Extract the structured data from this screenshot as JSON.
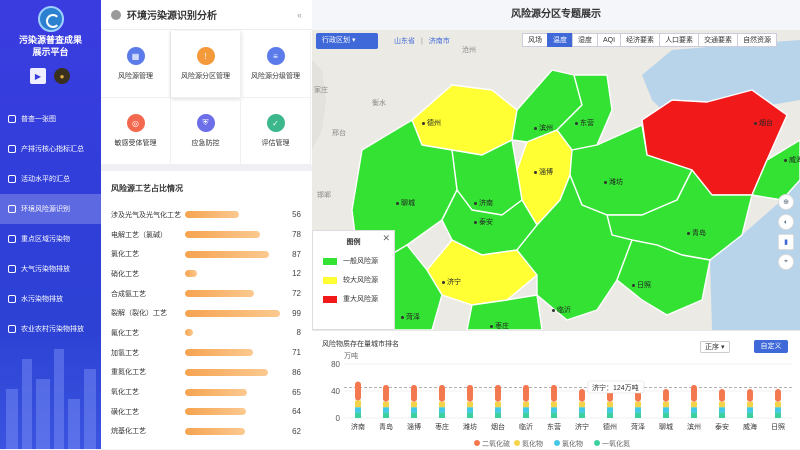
{
  "platform": {
    "title_line1": "污染源普查成果",
    "title_line2": "展示平台"
  },
  "nav": [
    {
      "label": "普查一张图",
      "active": false
    },
    {
      "label": "产排污核心指标汇总",
      "active": false
    },
    {
      "label": "活动水平的汇总",
      "active": false
    },
    {
      "label": "环境风险源识别",
      "active": true
    },
    {
      "label": "重点区域污染物",
      "active": false
    },
    {
      "label": "大气污染物排放",
      "active": false
    },
    {
      "label": "水污染物排放",
      "active": false
    },
    {
      "label": "农业农村污染物排放",
      "active": false
    }
  ],
  "panel": {
    "title": "环境污染源识别分析",
    "tiles": [
      {
        "label": "风险源管理",
        "icon": "building-icon",
        "color": "#5b7bea"
      },
      {
        "label": "风险源分区管理",
        "icon": "warning-icon",
        "color": "#f59a3a"
      },
      {
        "label": "风险源分级管理",
        "icon": "layers-icon",
        "color": "#5b7bea"
      },
      {
        "label": "敏感受体管理",
        "icon": "target-icon",
        "color": "#f4684f"
      },
      {
        "label": "应急防控",
        "icon": "shield-icon",
        "color": "#6c6fe8"
      },
      {
        "label": "评估管理",
        "icon": "clipboard-icon",
        "color": "#3cb88c"
      }
    ],
    "section_title": "风险源工艺占比情况",
    "process_rows": [
      {
        "label": "涉及光气及光气化工艺",
        "value": 56
      },
      {
        "label": "电解工艺（氯碱）",
        "value": 78
      },
      {
        "label": "氯化工艺",
        "value": 87
      },
      {
        "label": "硝化工艺",
        "value": 12
      },
      {
        "label": "合成氨工艺",
        "value": 72
      },
      {
        "label": "裂解（裂化）工艺",
        "value": 99
      },
      {
        "label": "氟化工艺",
        "value": 8
      },
      {
        "label": "加氢工艺",
        "value": 71
      },
      {
        "label": "重氮化工艺",
        "value": 86
      },
      {
        "label": "氧化工艺",
        "value": 65
      },
      {
        "label": "磺化工艺",
        "value": 64
      },
      {
        "label": "烷基化工艺",
        "value": 62
      }
    ]
  },
  "main": {
    "title": "风险源分区专题展示",
    "region_select": "行政区划",
    "breadcrumb_province": "山东省",
    "breadcrumb_sep": "|",
    "breadcrumb_city": "济南市",
    "tabs": [
      {
        "label": "风场",
        "active": false
      },
      {
        "label": "温度",
        "active": true
      },
      {
        "label": "湿度",
        "active": false
      },
      {
        "label": "AQI",
        "active": false
      },
      {
        "label": "经济要素",
        "active": false
      },
      {
        "label": "人口要素",
        "active": false
      },
      {
        "label": "交通要素",
        "active": false
      },
      {
        "label": "自然资源",
        "active": false
      }
    ]
  },
  "map_labels": {
    "outside": [
      "沧州",
      "衡水",
      "邢台",
      "家庄",
      "邯郸",
      "濮阳"
    ],
    "cities": [
      "德州",
      "滨州",
      "东营",
      "烟台",
      "淄博",
      "潍坊",
      "聊城",
      "济南",
      "泰安",
      "青岛",
      "济宁",
      "日照",
      "临沂",
      "菏泽",
      "枣庄",
      "威海"
    ]
  },
  "legend": {
    "title": "图例",
    "items": [
      {
        "label": "一般风险源",
        "color": "#33e233"
      },
      {
        "label": "较大风险源",
        "color": "#ffff33"
      },
      {
        "label": "重大风险源",
        "color": "#f2191b"
      }
    ]
  },
  "colors": {
    "low": "#33e233",
    "mid": "#ffff33",
    "high": "#f2191b",
    "sea": "#b8d4ea",
    "accent": "#3f68d8"
  },
  "chart": {
    "title": "风险物质存在量城市排名",
    "unit": "万吨",
    "sort": "正序",
    "custom_btn": "自定义",
    "tooltip": "济宁：124万吨"
  },
  "chart_data": {
    "type": "bar",
    "stacked": true,
    "categories": [
      "济南",
      "青岛",
      "淄博",
      "枣庄",
      "潍坊",
      "烟台",
      "临沂",
      "东营",
      "济宁",
      "德州",
      "菏泽",
      "聊城",
      "滨州",
      "泰安",
      "威海",
      "日照"
    ],
    "series": [
      {
        "name": "二氧化硫",
        "color": "#f4784f",
        "values": [
          28,
          25,
          25,
          25,
          25,
          25,
          25,
          25,
          19,
          25,
          19,
          19,
          25,
          19,
          19,
          19
        ]
      },
      {
        "name": "氮化物",
        "color": "#f5d349",
        "values": [
          10,
          8,
          8,
          8,
          8,
          8,
          8,
          8,
          8,
          8,
          8,
          8,
          8,
          8,
          8,
          8
        ]
      },
      {
        "name": "氯化物",
        "color": "#45c7e8",
        "values": [
          8,
          8,
          8,
          8,
          8,
          8,
          8,
          8,
          8,
          8,
          8,
          8,
          8,
          8,
          8,
          8
        ]
      },
      {
        "name": "一氧化氮",
        "color": "#3cd0a0",
        "values": [
          8,
          8,
          8,
          8,
          8,
          8,
          8,
          8,
          8,
          8,
          8,
          8,
          8,
          8,
          8,
          8
        ]
      }
    ],
    "ylim": [
      0,
      80
    ],
    "yticks": [
      0,
      40,
      80
    ],
    "reference_line": 45
  }
}
